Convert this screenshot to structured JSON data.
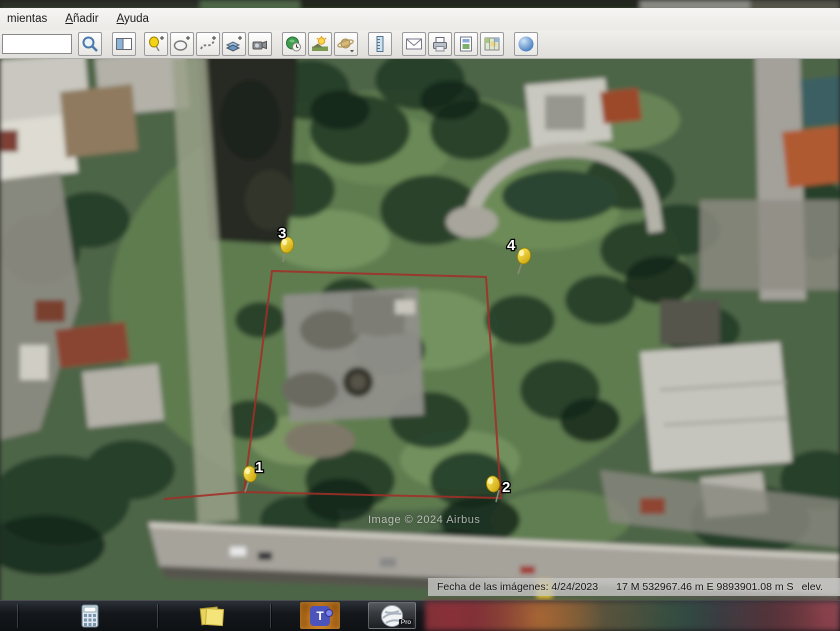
{
  "window": {
    "menu": {
      "items": [
        {
          "label": "mientas"
        },
        {
          "label": "Añadir"
        },
        {
          "label": "Ayuda"
        }
      ]
    },
    "toolbar": {
      "search": {
        "value": ""
      },
      "icons": [
        "search-icon",
        "sidebar-toggle-icon",
        "add-placemark-pushpin-icon",
        "add-polygon-icon",
        "add-path-icon",
        "add-image-overlay-icon",
        "record-tour-icon",
        "historical-imagery-clock-icon",
        "sunlight-icon",
        "planets-saturn-icon",
        "ruler-icon",
        "email-envelope-icon",
        "print-icon",
        "save-image-icon",
        "view-in-google-maps-icon",
        "globe-icon"
      ]
    }
  },
  "map": {
    "pins": [
      {
        "label": "1"
      },
      {
        "label": "2"
      },
      {
        "label": "3"
      },
      {
        "label": "4"
      }
    ],
    "boundary_color": "#a22f28",
    "watermark": "Image © 2024 Airbus"
  },
  "statusbar": {
    "imagery_date": "Fecha de las imágenes: 4/24/2023",
    "coordinates": "17 M 532967.46 m E 9893901.08 m S",
    "elevation_label": "elev."
  },
  "taskbar": {
    "icons": [
      "calculator-icon",
      "sticky-notes-icon",
      "teams-icon",
      "google-earth-pro-icon"
    ],
    "teams_letter": "T",
    "earth_badge": "Pro"
  }
}
